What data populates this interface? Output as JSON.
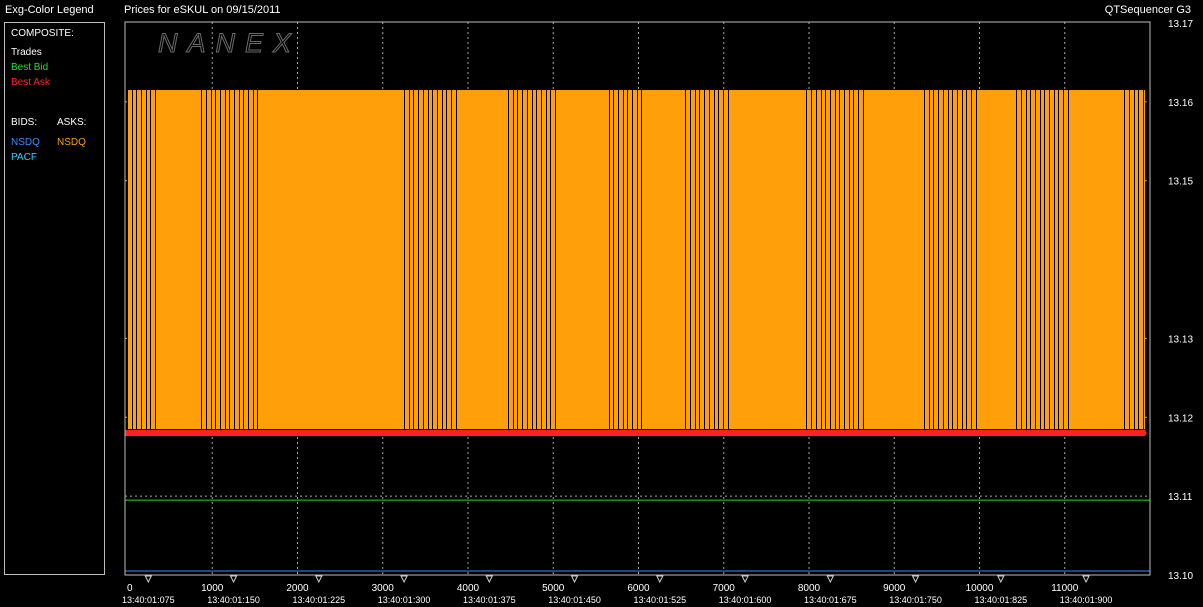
{
  "header": {
    "legend_title": "Exg-Color Legend",
    "chart_title": "Prices for  eSKUL  on  09/15/2011",
    "app_name": "QTSequencer G3"
  },
  "watermark": "NANEX",
  "legend": {
    "composite_label": "COMPOSITE:",
    "composite_items": [
      {
        "label": "Trades",
        "color": "#ffffff"
      },
      {
        "label": "Best Bid",
        "color": "#22dd22"
      },
      {
        "label": "Best Ask",
        "color": "#ff2222"
      }
    ],
    "bids_label": "BIDS:",
    "asks_label": "ASKS:",
    "bids": [
      {
        "label": "NSDQ",
        "color": "#3a8bff"
      },
      {
        "label": "PACF",
        "color": "#22d8ff"
      }
    ],
    "asks": [
      {
        "label": "NSDQ",
        "color": "#ff9f0a"
      }
    ]
  },
  "chart_data": {
    "type": "line",
    "title": "Prices for  eSKUL  on  09/15/2011",
    "xlabel": "",
    "ylabel": "",
    "xlim": [
      0,
      12000
    ],
    "ylim": [
      13.1,
      13.17
    ],
    "x_ticks": [
      0,
      1000,
      2000,
      3000,
      4000,
      5000,
      6000,
      7000,
      8000,
      9000,
      10000,
      11000
    ],
    "y_ticks": [
      "13.10",
      "13.11",
      "13.12",
      "13.13",
      "13.15",
      "13.16",
      "13.17"
    ],
    "y_tick_values": [
      13.1,
      13.11,
      13.12,
      13.13,
      13.15,
      13.16,
      13.17
    ],
    "time_labels": [
      {
        "x": 250,
        "label": "13:40:01:075"
      },
      {
        "x": 1250,
        "label": "13:40:01:150"
      },
      {
        "x": 2250,
        "label": "13:40:01:225"
      },
      {
        "x": 3250,
        "label": "13:40:01:300"
      },
      {
        "x": 4250,
        "label": "13:40:01:375"
      },
      {
        "x": 5250,
        "label": "13:40:01:450"
      },
      {
        "x": 6250,
        "label": "13:40:01:525"
      },
      {
        "x": 7250,
        "label": "13:40:01:600"
      },
      {
        "x": 8250,
        "label": "13:40:01:675"
      },
      {
        "x": 9250,
        "label": "13:40:01:750"
      },
      {
        "x": 10250,
        "label": "13:40:01:825"
      },
      {
        "x": 11250,
        "label": "13:40:01:900"
      }
    ],
    "grid": true,
    "series": [
      {
        "name": "NSDQ",
        "role": "ask quotes",
        "color": "#ff9f0a",
        "band": [
          13.1185,
          13.1615
        ],
        "x_range": [
          0,
          12000
        ]
      },
      {
        "name": "Best Ask",
        "color": "#ff2222",
        "value": 13.118
      },
      {
        "name": "Best Bid",
        "color": "#22dd22",
        "value": 13.1095
      },
      {
        "name": "NSDQ",
        "role": "bid",
        "color": "#3a8bff",
        "value": 13.1005
      }
    ],
    "quote_clusters": [
      [
        0,
        330
      ],
      [
        870,
        1550
      ],
      [
        3250,
        3900
      ],
      [
        4470,
        5050
      ],
      [
        5650,
        6070
      ],
      [
        6550,
        7050
      ],
      [
        7970,
        8650
      ],
      [
        9350,
        10000
      ],
      [
        10430,
        11050
      ],
      [
        11700,
        12000
      ]
    ],
    "quote_spacing": 55
  },
  "colors": {
    "background": "#000000",
    "grid": "#cfcfcf",
    "ask_band": "#ff9f0a",
    "best_ask": "#ff2222",
    "best_bid": "#22dd22",
    "nsdq_bid": "#3a8bff"
  }
}
